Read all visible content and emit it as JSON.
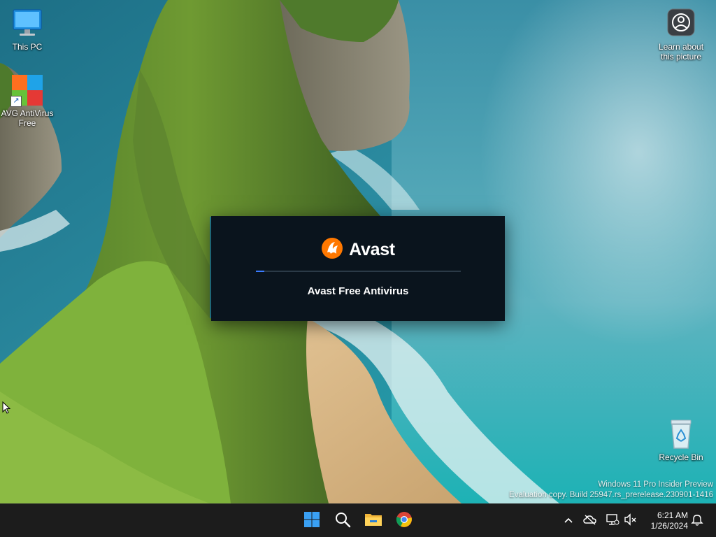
{
  "desktop": {
    "icons": [
      {
        "label": "This PC"
      },
      {
        "label": "AVG AntiVirus Free"
      },
      {
        "label": "Learn about this picture"
      },
      {
        "label": "Recycle Bin"
      }
    ]
  },
  "splash": {
    "brand": "Avast",
    "product": "Avast Free Antivirus",
    "progress": 0.04,
    "colors": {
      "background": "#0a141d",
      "accent": "#ff7800",
      "progress": "#3a7bff"
    }
  },
  "watermark": {
    "line1": "Windows 11 Pro Insider Preview",
    "line2": "Evaluation copy. Build 25947.rs_prerelease.230901-1416"
  },
  "taskbar": {
    "apps": [
      {
        "icon": "start-windows-icon"
      },
      {
        "icon": "search-icon"
      },
      {
        "icon": "file-explorer-icon"
      },
      {
        "icon": "chrome-icon"
      }
    ],
    "tray": {
      "icons": [
        "chevron-up-icon",
        "onedrive-offline-icon",
        "network-icon",
        "volume-muted-icon",
        "notification-bell-icon"
      ],
      "time": "6:21 AM",
      "date": "1/26/2024"
    }
  }
}
